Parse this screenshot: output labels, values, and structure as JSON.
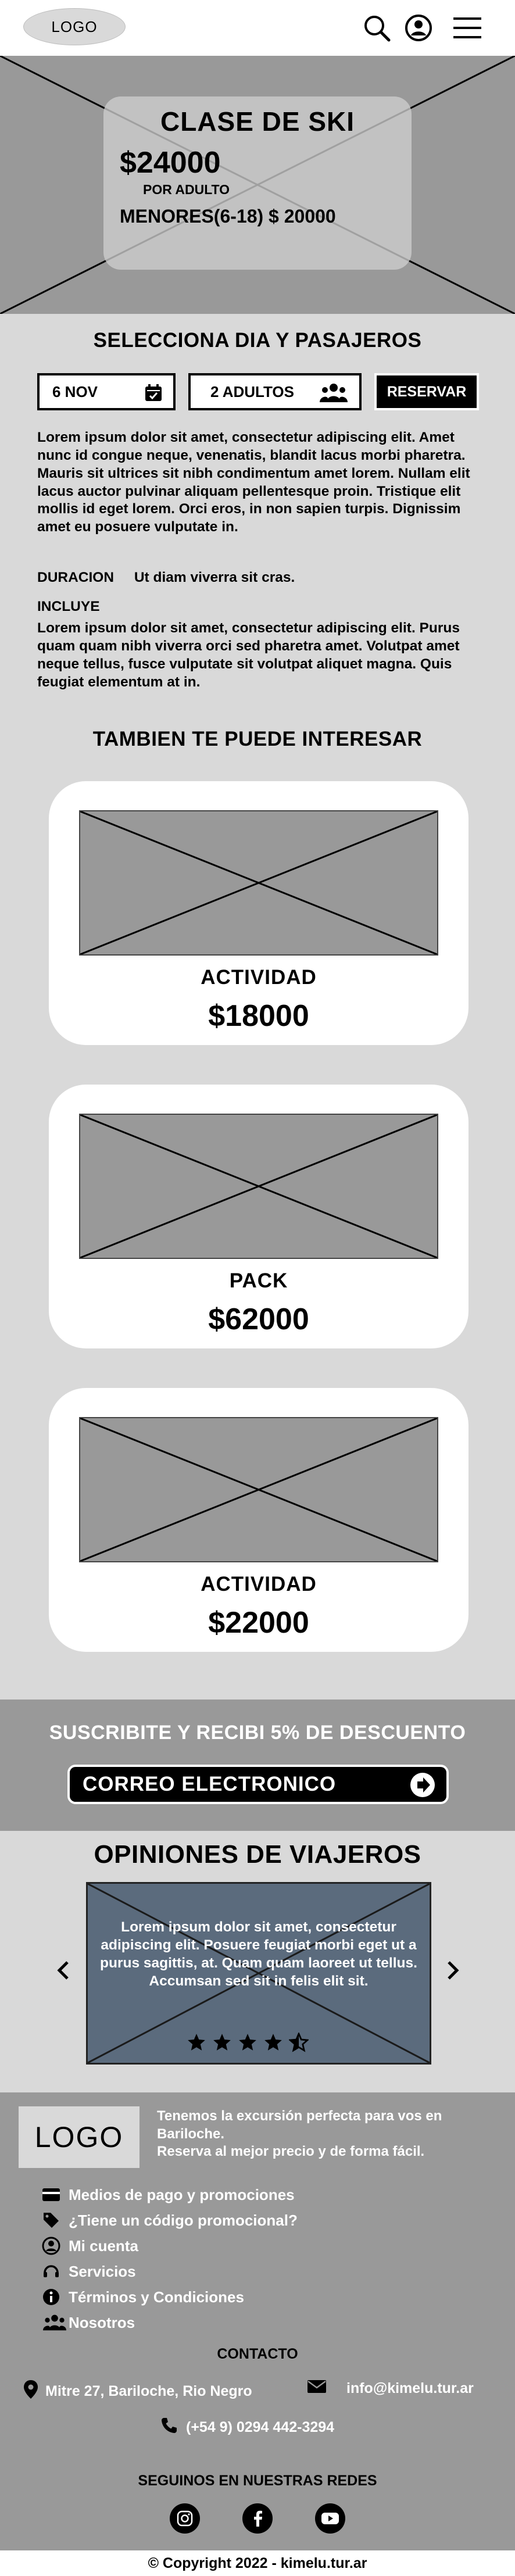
{
  "header": {
    "logo": "LOGO",
    "icons": [
      "search-icon",
      "user-icon",
      "menu-icon"
    ]
  },
  "hero": {
    "title": "CLASE DE SKI",
    "price": "$24000",
    "price_unit": "POR ADULTO",
    "minors_price": "MENORES(6-18) $ 20000"
  },
  "booking": {
    "heading": "SELECCIONA DIA Y PASAJEROS",
    "date_value": "6 NOV",
    "passengers_value": "2 ADULTOS",
    "reserve_label": "RESERVAR"
  },
  "description": {
    "paragraph": "Lorem ipsum dolor sit amet, consectetur adipiscing elit. Amet nunc id congue neque, venenatis, blandit lacus morbi pharetra. Mauris sit ultrices sit nibh condimentum amet lorem. Nullam elit lacus auctor pulvinar aliquam pellentesque proin. Tristique elit mollis id eget lorem. Orci eros, in non sapien turpis. Dignissim amet eu posuere vulputate in.",
    "duration_label": "DURACION",
    "duration_value": "Ut diam viverra sit cras.",
    "includes_label": "INCLUYE",
    "includes_text": "Lorem ipsum dolor sit amet, consectetur adipiscing elit. Purus quam quam nibh viverra orci sed pharetra amet. Volutpat amet neque tellus, fusce vulputate sit volutpat aliquet magna. Quis feugiat elementum at in."
  },
  "related": {
    "heading": "TAMBIEN TE PUEDE INTERESAR",
    "cards": [
      {
        "name": "ACTIVIDAD",
        "price": "$18000"
      },
      {
        "name": "PACK",
        "price": "$62000"
      },
      {
        "name": "ACTIVIDAD",
        "price": "$22000"
      }
    ]
  },
  "subscribe": {
    "heading": "SUSCRIBITE Y RECIBI 5% DE DESCUENTO",
    "email_placeholder": "CORREO ELECTRONICO"
  },
  "reviews": {
    "heading": "OPINIONES DE VIAJEROS",
    "text": "Lorem ipsum dolor sit amet, consectetur adipiscing elit. Posuere feugiat morbi eget ut a purus sagittis, at. Quam quam laoreet ut tellus. Accumsan sed sit in felis elit sit.",
    "rating": 4.5,
    "rating_max": 5
  },
  "footer": {
    "logo": "LOGO",
    "tagline_1": "Tenemos la excursión perfecta para vos en Bariloche.",
    "tagline_2": "Reserva al mejor precio y de forma fácil.",
    "links": [
      {
        "label": "Medios de pago y promociones",
        "icon": "card-icon"
      },
      {
        "label": "¿Tiene un código promocional?",
        "icon": "tag-icon"
      },
      {
        "label": "Mi cuenta",
        "icon": "user-icon"
      },
      {
        "label": "Servicios",
        "icon": "support-icon"
      },
      {
        "label": "Términos y Condiciones",
        "icon": "info-icon"
      },
      {
        "label": "Nosotros",
        "icon": "group-icon"
      }
    ],
    "contact_heading": "CONTACTO",
    "address": "Mitre 27, Bariloche, Rio Negro",
    "email": "info@kimelu.tur.ar",
    "phone": "(+54 9) 0294 442-3294",
    "social_heading": "SEGUINOS EN NUESTRAS REDES",
    "social": [
      "instagram-icon",
      "facebook-icon",
      "youtube-icon"
    ],
    "copyright": "© Copyright 2022 - kimelu.tur.ar"
  },
  "colors": {
    "background": "#d9d9d9",
    "placeholder": "#999999",
    "review_card": "#5b6b7d",
    "white": "#ffffff",
    "black": "#000000"
  }
}
